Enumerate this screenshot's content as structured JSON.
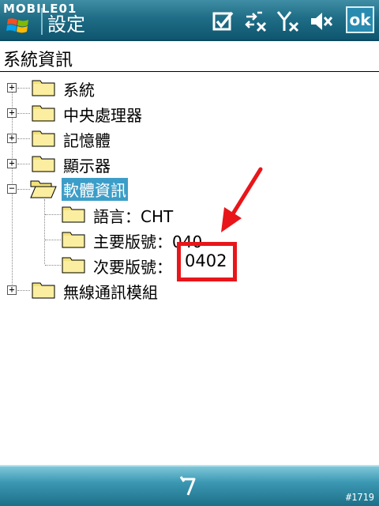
{
  "titlebar": {
    "brand": "MOBILE01",
    "title": "設定",
    "ok_label": "ok"
  },
  "section": {
    "title": "系統資訊"
  },
  "tree": {
    "items": [
      {
        "label": "系統",
        "expander": "+"
      },
      {
        "label": "中央處理器",
        "expander": "+"
      },
      {
        "label": "記憶體",
        "expander": "+"
      },
      {
        "label": "顯示器",
        "expander": "+"
      },
      {
        "label": "軟體資訊",
        "expander": "−",
        "selected": true,
        "children": [
          {
            "label": "語言：CHT"
          },
          {
            "label": "主要版號：040"
          },
          {
            "label": "次要版號："
          }
        ]
      },
      {
        "label": "無線通訊模組",
        "expander": "+"
      }
    ]
  },
  "annotation": {
    "highlight_value": "0402",
    "color": "#e8161a"
  },
  "footer": {
    "watermark": "#1719"
  },
  "icons": [
    "windows-logo-icon",
    "checkbox-icon",
    "sync-disconnected-icon",
    "signal-off-icon",
    "speaker-mute-icon",
    "folder-icon",
    "back-icon",
    "arrow-icon"
  ]
}
